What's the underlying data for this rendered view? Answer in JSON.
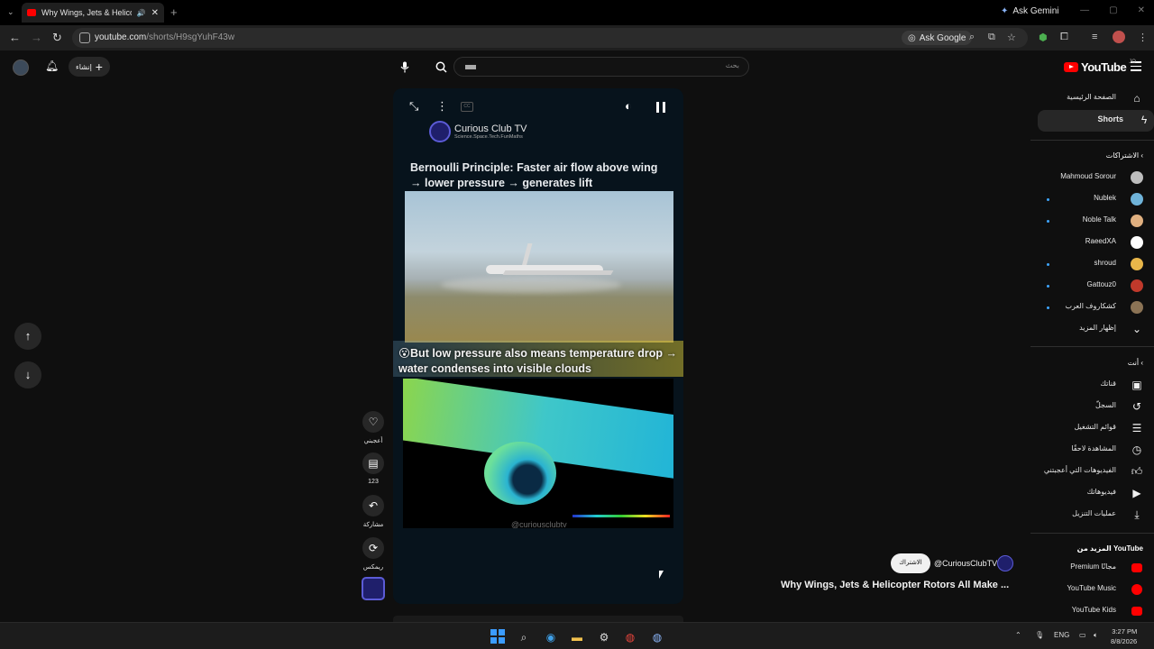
{
  "browser": {
    "tab_title": "Why Wings, Jets & Helicopt",
    "ask_gemini": "Ask Gemini",
    "url_host": "youtube.com",
    "url_path": "/shorts/H9sgYuhF43w",
    "ask_google": "Ask Google"
  },
  "header": {
    "create_label": "إنشاء",
    "search_placeholder": "بحث",
    "logo_text": "YouTube",
    "logo_country": "JO"
  },
  "sidebar": {
    "main": [
      {
        "label": "الصفحة الرئيسية",
        "icon": "home-icon"
      },
      {
        "label": "Shorts",
        "icon": "shorts-icon",
        "active": true
      }
    ],
    "subscriptions_heading": "الاشتراكات",
    "subscriptions": [
      {
        "label": "Mahmoud Sorour",
        "dot": false,
        "color": "#bdbdbd"
      },
      {
        "label": "Nublek",
        "dot": true,
        "color": "#6fb3d9"
      },
      {
        "label": "Noble Talk",
        "dot": true,
        "color": "#e0b080"
      },
      {
        "label": "RaeedXA",
        "dot": false,
        "color": "#ffffff"
      },
      {
        "label": "shroud",
        "dot": true,
        "color": "#e8b64a"
      },
      {
        "label": "Gattouz0",
        "dot": true,
        "color": "#c0392b"
      },
      {
        "label": "كشكاروف العرب",
        "dot": true,
        "color": "#8b7355"
      }
    ],
    "show_more": "إظهار المزيد",
    "you_heading": "أنت",
    "you": [
      {
        "label": "قناتك",
        "icon": "channel-icon"
      },
      {
        "label": "السجلّ",
        "icon": "history-icon"
      },
      {
        "label": "قوائم التشغيل",
        "icon": "playlists-icon"
      },
      {
        "label": "المشاهدة لاحقًا",
        "icon": "watch-later-icon"
      },
      {
        "label": "الفيديوهات التي أعجبتني",
        "icon": "liked-icon"
      },
      {
        "label": "فيديوهاتك",
        "icon": "your-videos-icon"
      },
      {
        "label": "عمليات التنزيل",
        "icon": "download-icon"
      }
    ],
    "more_heading": "المزيد من YouTube",
    "more": [
      {
        "label": "Premium مجانًا"
      },
      {
        "label": "YouTube Music"
      },
      {
        "label": "YouTube Kids"
      }
    ]
  },
  "player": {
    "brand_name": "Curious Club TV",
    "brand_tagline": "Science.Space.Tech.FunMaths",
    "headline1": "Bernoulli Principle: Faster air flow above wing → lower pressure → generates lift",
    "headline2": "😮But low pressure also means temperature drop → water condenses into visible clouds",
    "watermark": "@curiousclubtv"
  },
  "actions": {
    "like_label": "أعجبني",
    "comments_count": "123",
    "share_label": "مشاركة",
    "remix_label": "ريمكس"
  },
  "short": {
    "subscribe_label": "الاشتراك",
    "handle": "@CuriousClubTV",
    "title": "Why Wings, Jets & Helicopter Rotors All Make ..."
  },
  "taskbar": {
    "language": "ENG",
    "time": "3:27 PM",
    "date": "8/8/2026"
  },
  "colors": {
    "accent_red": "#ff0000",
    "background": "#0f0f0f",
    "subscription_dot": "#3ea6ff"
  }
}
